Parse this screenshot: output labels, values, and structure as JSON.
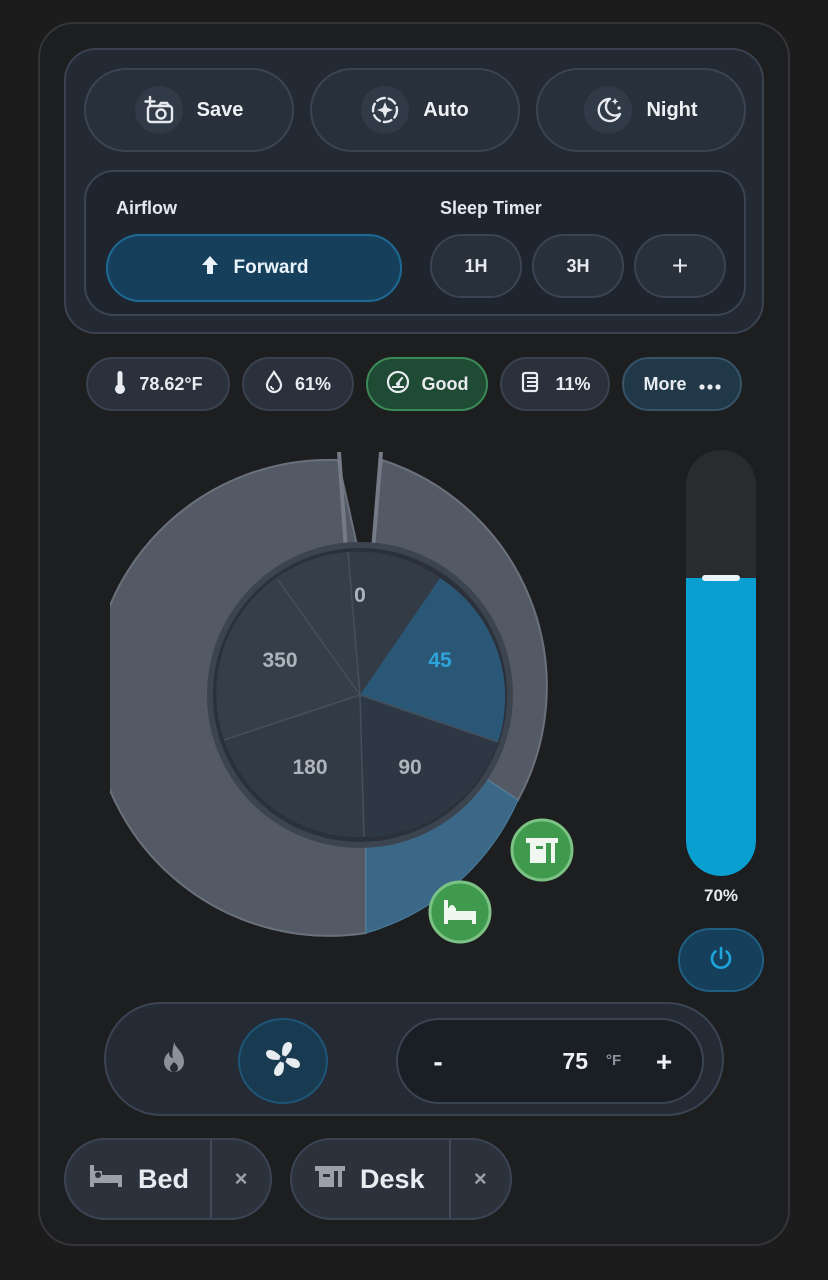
{
  "modes": [
    {
      "label": "Save",
      "icon": "camera-plus-icon"
    },
    {
      "label": "Auto",
      "icon": "auto-sparkle-icon"
    },
    {
      "label": "Night",
      "icon": "moon-stars-icon"
    }
  ],
  "airflow": {
    "label": "Airflow",
    "value": "Forward",
    "icon": "arrow-up-icon"
  },
  "sleep_timer": {
    "label": "Sleep Timer",
    "options": [
      "1H",
      "3H"
    ],
    "add_label": "+"
  },
  "sensors": {
    "temperature": "78.62°F",
    "humidity": "61%",
    "air_quality": "Good",
    "filter": "11%",
    "more": "More"
  },
  "dial": {
    "labels": [
      "0",
      "45",
      "90",
      "180",
      "350"
    ],
    "active_label": "45",
    "active_color": "#2ea3d8"
  },
  "speed": {
    "percent": 70,
    "display": "70%"
  },
  "thermostat": {
    "minus": "-",
    "value": "75",
    "unit": "°F",
    "plus": "+"
  },
  "zones": [
    {
      "label": "Bed",
      "icon": "bed-icon",
      "close": "×"
    },
    {
      "label": "Desk",
      "icon": "desk-icon",
      "close": "×"
    }
  ],
  "colors": {
    "accent": "#0a9fd1",
    "good": "#3b8a55",
    "zone_marker": "#3f9a4d"
  }
}
